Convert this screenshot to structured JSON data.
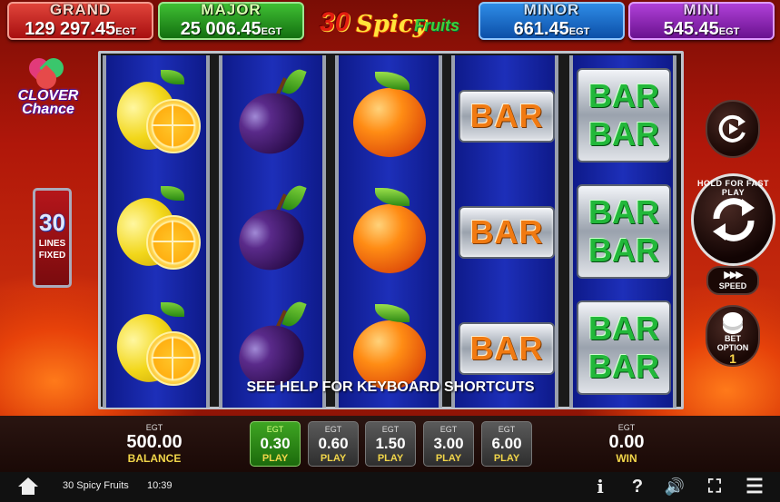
{
  "jackpots": {
    "grand": {
      "name": "GRAND",
      "value": "129 297.45",
      "currency": "EGT"
    },
    "major": {
      "name": "MAJOR",
      "value": "25 006.45",
      "currency": "EGT"
    },
    "minor": {
      "name": "MINOR",
      "value": "661.45",
      "currency": "EGT"
    },
    "mini": {
      "name": "MINI",
      "value": "545.45",
      "currency": "EGT"
    }
  },
  "logo": {
    "num": "30",
    "spicy": "Spicy",
    "fruits": "Fruits"
  },
  "clover": {
    "line1": "CLOVER",
    "line2": "Chance"
  },
  "lines": {
    "count": "30",
    "line1": "LINES",
    "line2": "FIXED"
  },
  "reels": [
    [
      "lemon",
      "lemon",
      "lemon"
    ],
    [
      "plum",
      "plum",
      "plum"
    ],
    [
      "orange",
      "orange",
      "orange"
    ],
    [
      "bar",
      "bar",
      "bar"
    ],
    [
      "double-bar",
      "double-bar",
      "double-bar"
    ]
  ],
  "symbols": {
    "bar": "BAR"
  },
  "hint": "SEE HELP FOR KEYBOARD SHORTCUTS",
  "controls": {
    "spin_label": "HOLD FOR FAST PLAY",
    "speed_label": "SPEED",
    "bet_option_label1": "BET",
    "bet_option_label2": "OPTION",
    "bet_option_value": "1"
  },
  "panel": {
    "balance": {
      "currency": "EGT",
      "value": "500.00",
      "label": "BALANCE"
    },
    "win": {
      "currency": "EGT",
      "value": "0.00",
      "label": "WIN"
    },
    "bets": [
      {
        "currency": "EGT",
        "value": "0.30",
        "label": "PLAY",
        "active": true
      },
      {
        "currency": "EGT",
        "value": "0.60",
        "label": "PLAY",
        "active": false
      },
      {
        "currency": "EGT",
        "value": "1.50",
        "label": "PLAY",
        "active": false
      },
      {
        "currency": "EGT",
        "value": "3.00",
        "label": "PLAY",
        "active": false
      },
      {
        "currency": "EGT",
        "value": "6.00",
        "label": "PLAY",
        "active": false
      }
    ]
  },
  "statusbar": {
    "game_name": "30 Spicy Fruits",
    "time": "10:39",
    "info": "i",
    "help": "?",
    "sound": "🔊",
    "fullscreen": "⛶",
    "menu": "☰"
  },
  "colors": {
    "active_bet": "#3ea522",
    "label_gold": "#f2d64a"
  }
}
